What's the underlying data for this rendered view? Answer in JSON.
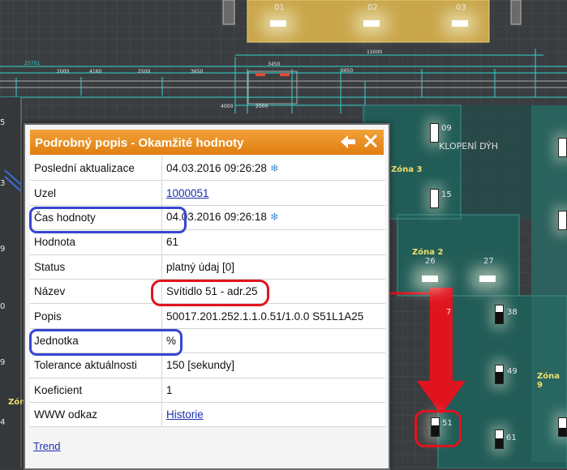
{
  "plan": {
    "top_lamps": [
      "01",
      "02",
      "03"
    ],
    "dimensions": [
      "25701",
      "2000",
      "4160",
      "2500",
      "3650",
      "3450",
      "15000",
      "4000",
      "2000",
      "3650"
    ],
    "side_numbers": [
      "5",
      "3",
      "9",
      "0",
      "9",
      "4"
    ],
    "room_label": "KLOPENÍ DÝH",
    "zones": [
      "Zóna 3",
      "Zóna 2",
      "Zóna 9",
      "Zón"
    ],
    "fixtures": [
      "09",
      "15",
      "26",
      "27",
      "7",
      "38",
      "49",
      "51",
      "61"
    ],
    "colors": {
      "accent": "#e8881c",
      "annotation_blue": "#3845d0",
      "annotation_red": "#e0141e",
      "zone_teal": "#1f5f5a",
      "cad_cyan": "#2fd6d0"
    }
  },
  "dialog": {
    "title": "Podrobný popis - Okamžité hodnoty",
    "icons": [
      "back-arrow-icon",
      "close-icon",
      "refresh-snowflake-icon"
    ],
    "rows": [
      {
        "label": "Poslední aktualizace",
        "value": "04.03.2016 09:26:28",
        "icon": true
      },
      {
        "label": "Uzel",
        "value": "1000051",
        "link": true
      },
      {
        "label": "Čas hodnoty",
        "value": "04.03.2016 09:26:18",
        "icon": true
      },
      {
        "label": "Hodnota",
        "value": "61"
      },
      {
        "label": "Status",
        "value": "platný údaj [0]"
      },
      {
        "label": "Název",
        "value": "Svítidlo 51 - adr.25"
      },
      {
        "label": "Popis",
        "value": "50017.201.252.1.1.0.51/1.0.0 S51L1A25"
      },
      {
        "label": "Jednotka",
        "value": "%"
      },
      {
        "label": "Tolerance aktuálnosti",
        "value": "150 [sekundy]"
      },
      {
        "label": "Koeficient",
        "value": "1"
      },
      {
        "label": "WWW odkaz",
        "value": "Historie",
        "link": true
      }
    ],
    "footer_link": "Trend"
  }
}
